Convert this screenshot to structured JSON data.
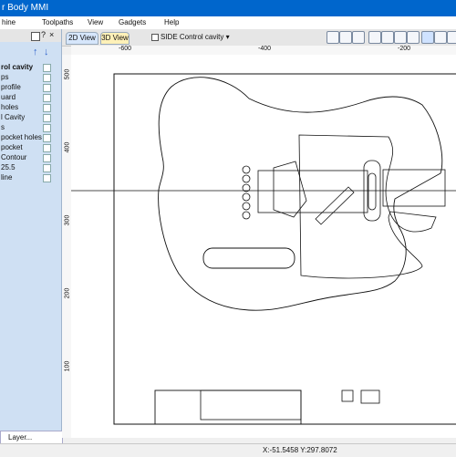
{
  "window": {
    "title": "r Body MMI"
  },
  "menu": [
    "hine",
    "Toolpaths",
    "View",
    "Gadgets",
    "Help"
  ],
  "panel": {
    "items": [
      {
        "label": "rol cavity",
        "selected": true
      },
      {
        "label": "ps"
      },
      {
        "label": "profile"
      },
      {
        "label": "uard"
      },
      {
        "label": "holes"
      },
      {
        "label": "l Cavity"
      },
      {
        "label": "s"
      },
      {
        "label": "pocket holes"
      },
      {
        "label": "pocket"
      },
      {
        "label": "Contour"
      },
      {
        "label": "25.5"
      },
      {
        "label": "line"
      }
    ],
    "bottom_label": "Layer..."
  },
  "tabs": {
    "view2d": "2D View",
    "view3d": "3D View",
    "layer_select": "SIDE Control cavity"
  },
  "ruler": {
    "top_labels": [
      "-600",
      "-400",
      "-200"
    ],
    "left_labels": [
      "500",
      "400",
      "300",
      "200",
      "100"
    ]
  },
  "status": {
    "coords": "X:-51.5458 Y:297.8072"
  },
  "colors": {
    "titlebar": "#0066cc",
    "panel": "#cfe0f3",
    "drawing": "#111111"
  }
}
